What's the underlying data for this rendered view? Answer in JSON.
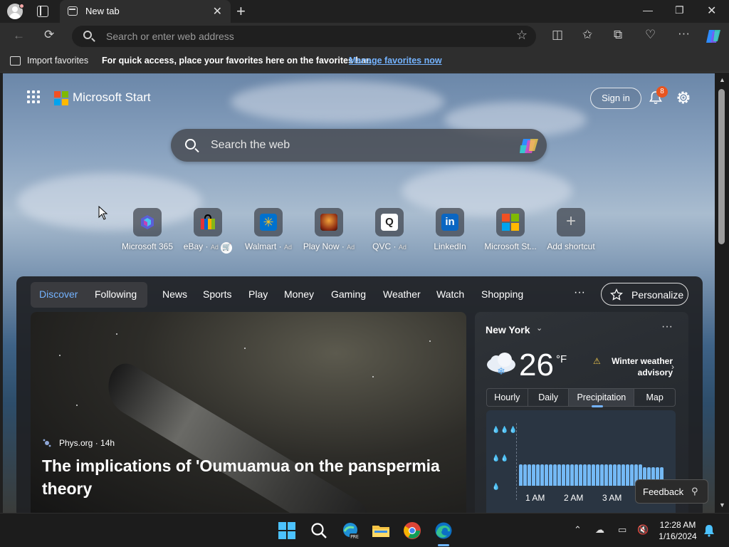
{
  "browser": {
    "tab_title": "New tab",
    "omnibox_placeholder": "Search or enter web address",
    "favbar": {
      "import": "Import favorites",
      "message": "For quick access, place your favorites here on the favorites bar.",
      "link": "Manage favorites now"
    }
  },
  "header": {
    "brand": "Microsoft Start",
    "signin": "Sign in",
    "notification_count": "8"
  },
  "search": {
    "placeholder": "Search the web"
  },
  "shortcuts": [
    {
      "label": "Microsoft 365",
      "ad": ""
    },
    {
      "label": "eBay",
      "ad": "Ad"
    },
    {
      "label": "Walmart",
      "ad": "Ad"
    },
    {
      "label": "Play Now",
      "ad": "Ad"
    },
    {
      "label": "QVC",
      "ad": "Ad"
    },
    {
      "label": "LinkedIn",
      "ad": ""
    },
    {
      "label": "Microsoft St...",
      "ad": ""
    },
    {
      "label": "Add shortcut",
      "ad": ""
    }
  ],
  "feed": {
    "pivots": [
      "Discover",
      "Following",
      "News",
      "Sports",
      "Play",
      "Money",
      "Gaming",
      "Weather",
      "Watch",
      "Shopping"
    ],
    "more": "···",
    "personalize": "Personalize",
    "hero": {
      "source": "Phys.org · 14h",
      "title": "The implications of 'Oumuamua on the panspermia theory"
    }
  },
  "weather": {
    "city": "New York",
    "temp": "26",
    "unit": "°F",
    "alert": "Winter weather advisory",
    "tabs": [
      "Hourly",
      "Daily",
      "Precipitation",
      "Map"
    ],
    "x_labels": [
      "1 AM",
      "2 AM",
      "3 AM"
    ],
    "precipitation_bar_levels": [
      0.93,
      0.93,
      0.93,
      0.93,
      0.93,
      0.93,
      0.93,
      0.93,
      0.93,
      0.93,
      0.93,
      0.93,
      0.93,
      0.93,
      0.93,
      0.93,
      0.93,
      0.93,
      0.93,
      0.93,
      0.93,
      0.93,
      0.93,
      0.93,
      0.93,
      0.93,
      0.93,
      0.93,
      0.93,
      0.81,
      0.81,
      0.81,
      0.81,
      0.81
    ]
  },
  "feedback": "Feedback",
  "clock": {
    "time": "12:28 AM",
    "date": "1/16/2024"
  }
}
